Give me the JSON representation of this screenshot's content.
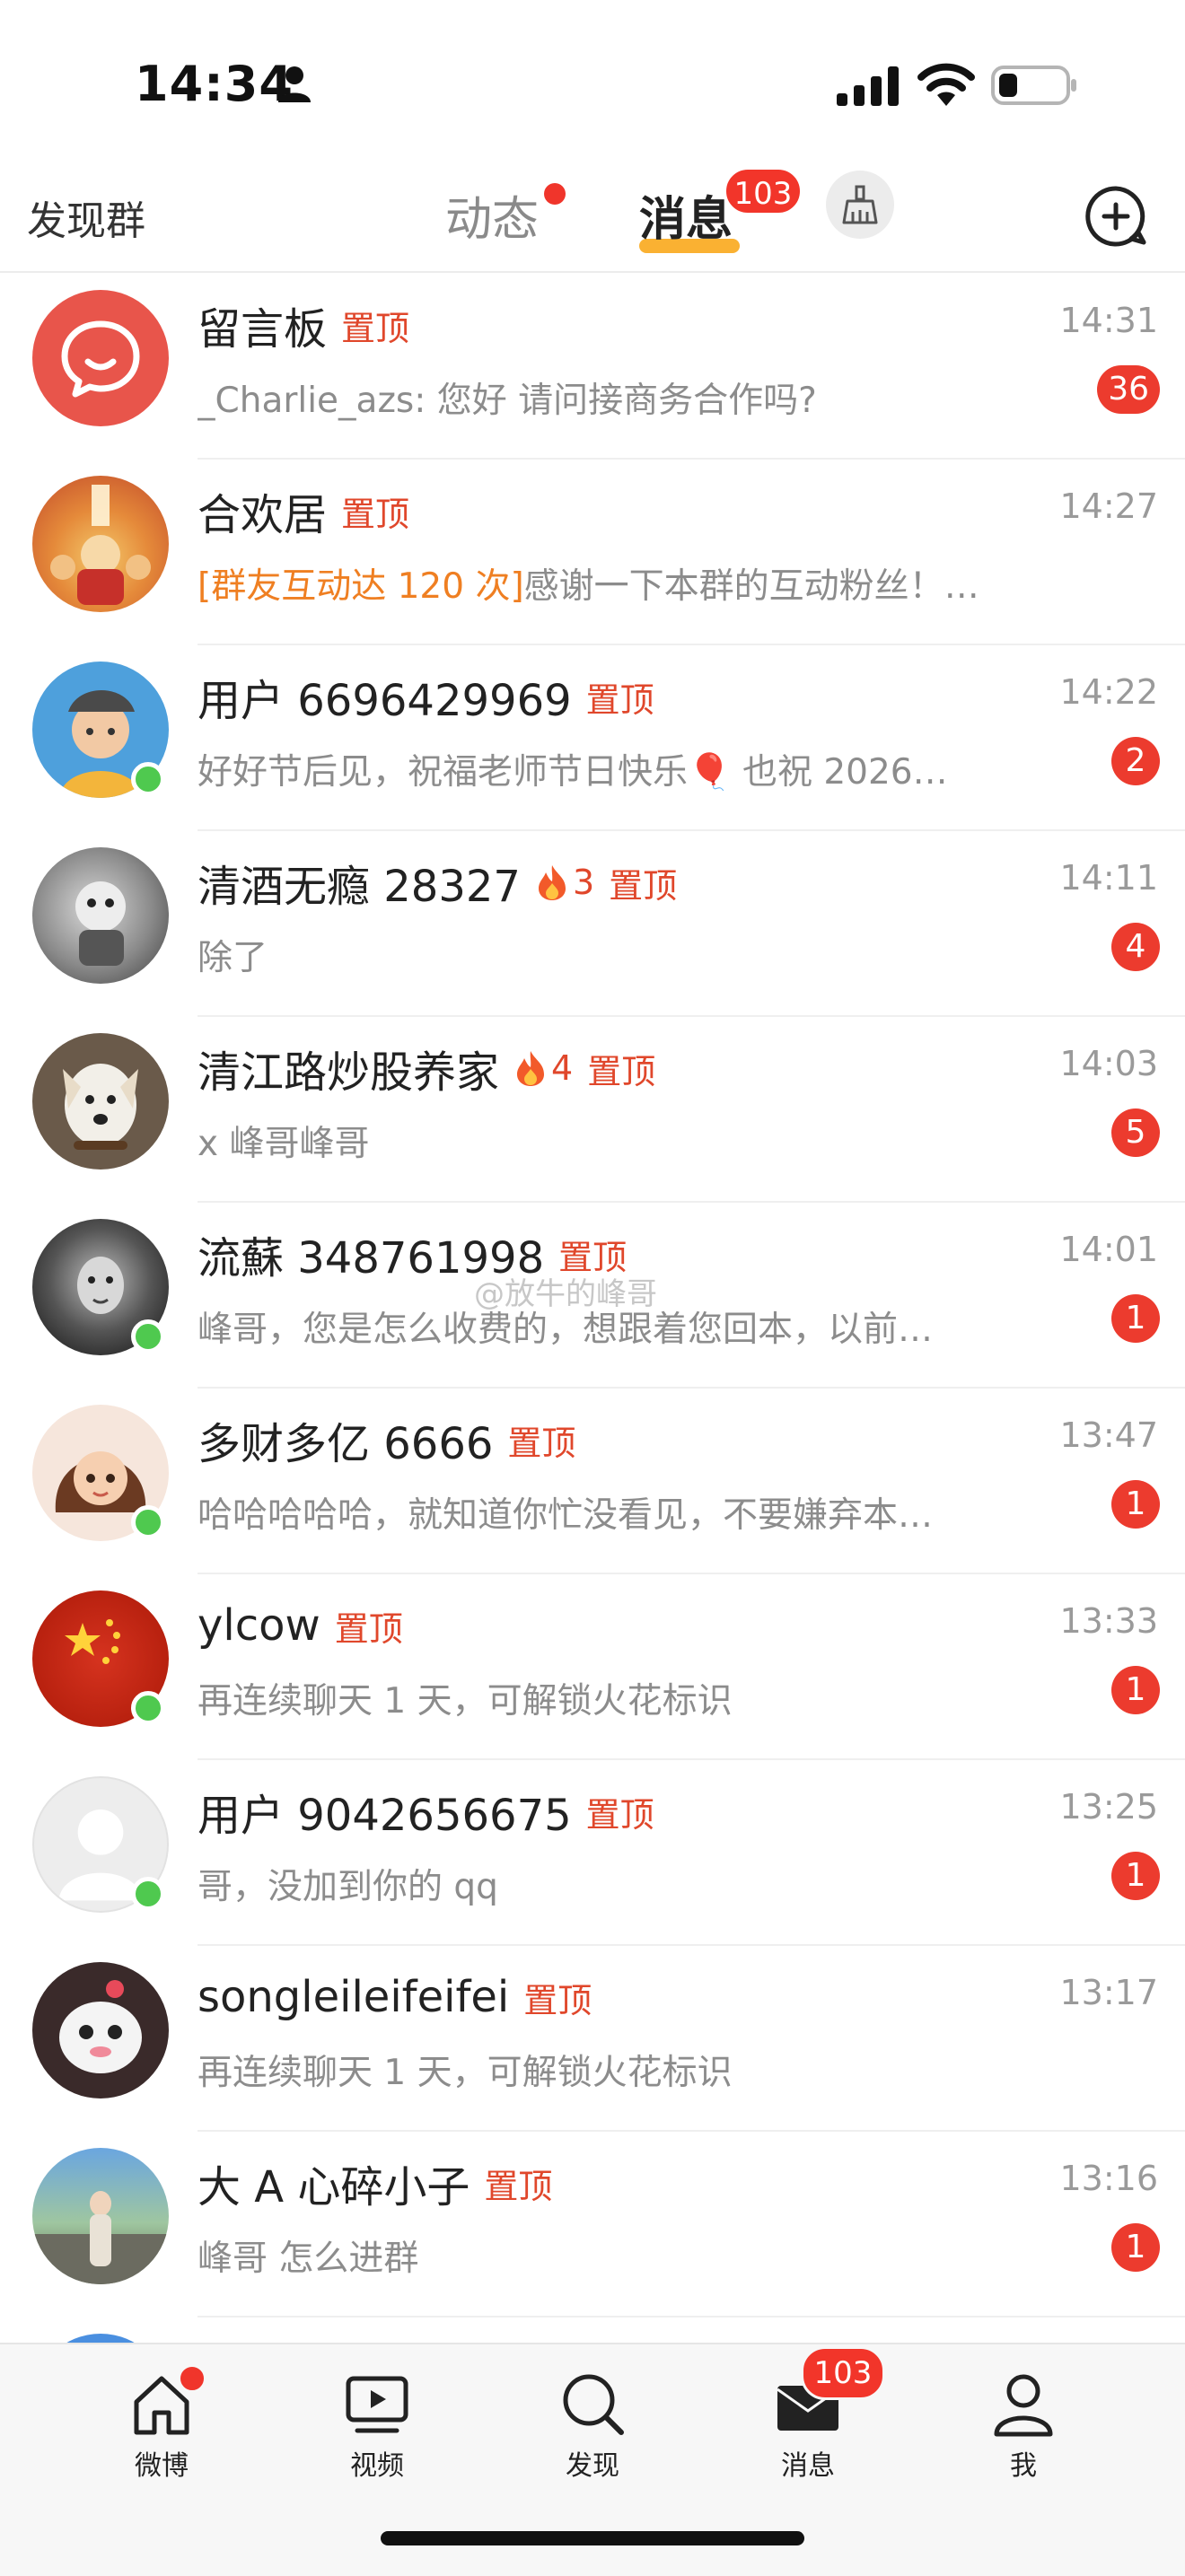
{
  "status_bar": {
    "time": "14:34"
  },
  "header": {
    "discover_label": "发现群",
    "tabs": [
      {
        "label": "动态",
        "has_dot": true
      },
      {
        "label": "消息",
        "badge": "103",
        "active": true
      }
    ],
    "accent_color": "#f9a81c",
    "icons": [
      "broom-icon",
      "add-chat-icon"
    ]
  },
  "chats": [
    {
      "name": "留言板",
      "tag": "置顶",
      "time": "14:31",
      "preview": "_Charlie_azs: 您好 请问接商务合作吗?",
      "count": "36"
    },
    {
      "name": "合欢居",
      "tag": "置顶",
      "time": "14:27",
      "preview_highlight": "[群友互动达 120 次]",
      "preview": "感谢一下本群的互动粉丝！发红包"
    },
    {
      "name": "用户 6696429969",
      "tag": "置顶",
      "time": "14:22",
      "preview": "好好节后见，祝福老师节日快乐🎈 也祝 2026…",
      "count": "2",
      "online": true
    },
    {
      "name": "清酒无瘾 28327",
      "fire": "3",
      "tag": "置顶",
      "time": "14:11",
      "preview": "除了",
      "count": "4"
    },
    {
      "name": "清江路炒股养家",
      "fire": "4",
      "tag": "置顶",
      "time": "14:03",
      "preview": "x 峰哥峰哥",
      "count": "5"
    },
    {
      "name": "流蘇 348761998",
      "tag": "置顶",
      "time": "14:01",
      "preview": "峰哥，您是怎么收费的，想跟着您回本，以前…",
      "count": "1",
      "online": true
    },
    {
      "name": "多财多亿 6666",
      "tag": "置顶",
      "time": "13:47",
      "preview": "哈哈哈哈哈，就知道你忙没看见，不要嫌弃本…",
      "count": "1",
      "online": true
    },
    {
      "name": "ylcow",
      "tag": "置顶",
      "time": "13:33",
      "preview": "再连续聊天 1 天，可解锁火花标识",
      "count": "1",
      "online": true
    },
    {
      "name": "用户 9042656675",
      "tag": "置顶",
      "time": "13:25",
      "preview": "哥，没加到你的 qq",
      "count": "1",
      "online": true
    },
    {
      "name": "songleileifeifei",
      "tag": "置顶",
      "time": "13:17",
      "preview": "再连续聊天 1 天，可解锁火花标识"
    },
    {
      "name": "大 A 心碎小子",
      "tag": "置顶",
      "time": "13:16",
      "preview": "峰哥 怎么进群",
      "count": "1"
    }
  ],
  "watermark": "@放牛的峰哥",
  "tabbar": {
    "items": [
      {
        "label": "微博",
        "icon": "home-icon",
        "has_dot": true
      },
      {
        "label": "视频",
        "icon": "video-icon"
      },
      {
        "label": "发现",
        "icon": "search-icon"
      },
      {
        "label": "消息",
        "icon": "message-icon",
        "badge": "103"
      },
      {
        "label": "我",
        "icon": "profile-icon"
      }
    ]
  }
}
